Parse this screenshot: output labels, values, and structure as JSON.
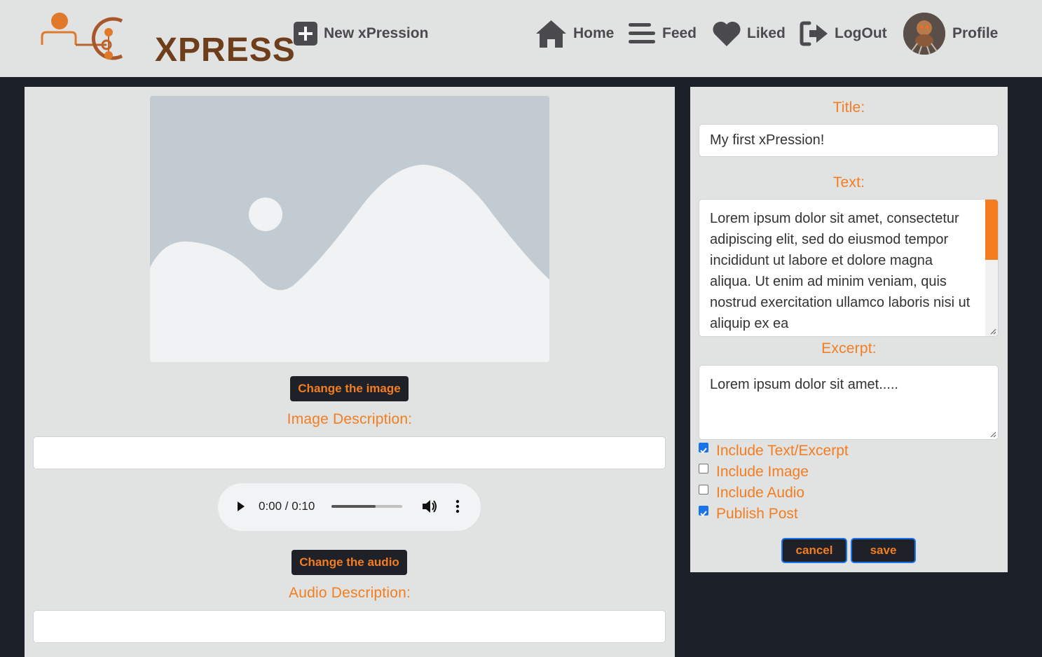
{
  "brand": {
    "logo_text": "XPRESS",
    "accent_color": "#f47d20",
    "dark_color": "#1c2028"
  },
  "nav": {
    "new_label": "New xPression",
    "home_label": "Home",
    "feed_label": "Feed",
    "liked_label": "Liked",
    "logout_label": "LogOut",
    "profile_label": "Profile"
  },
  "editor": {
    "change_image_label": "Change the image",
    "image_description_label": "Image Description:",
    "image_description_value": "",
    "audio": {
      "time_display": "0:00 / 0:10",
      "played_fraction": 0.62
    },
    "change_audio_label": "Change the audio",
    "audio_description_label": "Audio Description:",
    "audio_description_value": ""
  },
  "form": {
    "title_label": "Title:",
    "title_value": "My first xPression!",
    "text_label": "Text:",
    "text_value": "Lorem ipsum dolor sit amet, consectetur adipiscing elit, sed do eiusmod tempor incididunt ut labore et dolore magna aliqua. Ut enim ad minim veniam, quis nostrud exercitation ullamco laboris nisi ut aliquip ex ea",
    "excerpt_label": "Excerpt:",
    "excerpt_value": "Lorem ipsum dolor sit amet.....",
    "options": [
      {
        "label": "Include Text/Excerpt",
        "checked": true
      },
      {
        "label": "Include Image",
        "checked": false
      },
      {
        "label": "Include Audio",
        "checked": false
      },
      {
        "label": "Publish Post",
        "checked": true
      }
    ],
    "cancel_label": "cancel",
    "save_label": "save"
  }
}
